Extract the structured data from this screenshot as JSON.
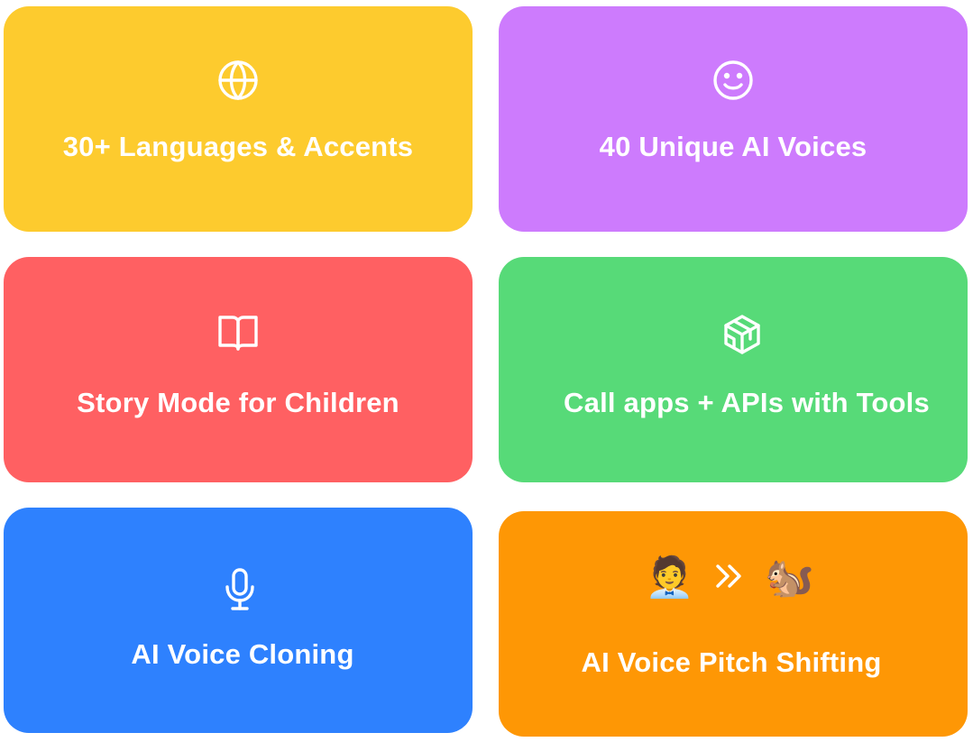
{
  "cards": [
    {
      "title": "30+ Languages & Accents",
      "icon": "globe-icon",
      "color": "#FDCB2E"
    },
    {
      "title": "40 Unique AI Voices",
      "icon": "smiley-icon",
      "color": "#CD7BFD"
    },
    {
      "title": "Story Mode for Children",
      "icon": "book-icon",
      "color": "#FF6062"
    },
    {
      "title": "Call apps + APIs with Tools",
      "icon": "cube-icon",
      "color": "#57DA78"
    },
    {
      "title": "AI Voice Cloning",
      "icon": "microphone-icon",
      "color": "#2E81FE"
    },
    {
      "title": "AI Voice Pitch Shifting",
      "icon": "pitch-shift-icons",
      "color": "#FE9705",
      "emoji_from": "🧑‍💼",
      "emoji_to": "🐿️"
    }
  ]
}
